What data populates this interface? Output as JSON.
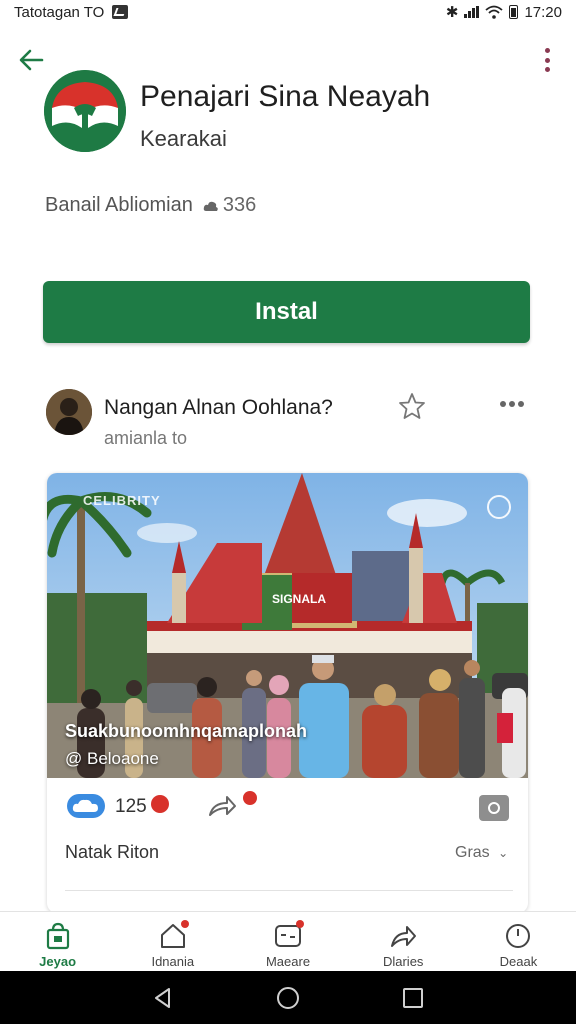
{
  "status_bar": {
    "left_text": "Tatotagan TO",
    "time": "17:20"
  },
  "colors": {
    "brand_green": "#1e7b45",
    "notification_red": "#d8322b",
    "like_blue": "#3a8be0"
  },
  "app": {
    "name": "Penajari Sina Neayah",
    "developer": "Kearakai",
    "meta_label": "Banail Abliomian",
    "download_count": "336",
    "install_label": "Instal"
  },
  "post": {
    "author": "Nangan Alnan Oohlana?",
    "subtitle": "amianla to",
    "image_watermark": "CELIBRITY",
    "image_caption": "Suakbunoomhnqamaplonah",
    "image_handle": "@ Beloaone",
    "image_sign": "SIGNALA",
    "like_count": "125",
    "comment_label": "Natak Riton",
    "comment_sort": "Gras"
  },
  "bottom_nav": {
    "items": [
      {
        "label": "Jeyao",
        "icon": "store-bag-icon"
      },
      {
        "label": "Idnania",
        "icon": "home-icon"
      },
      {
        "label": "Maeare",
        "icon": "message-icon"
      },
      {
        "label": "Dlaries",
        "icon": "share-icon"
      },
      {
        "label": "Deaak",
        "icon": "clock-icon"
      }
    ]
  }
}
